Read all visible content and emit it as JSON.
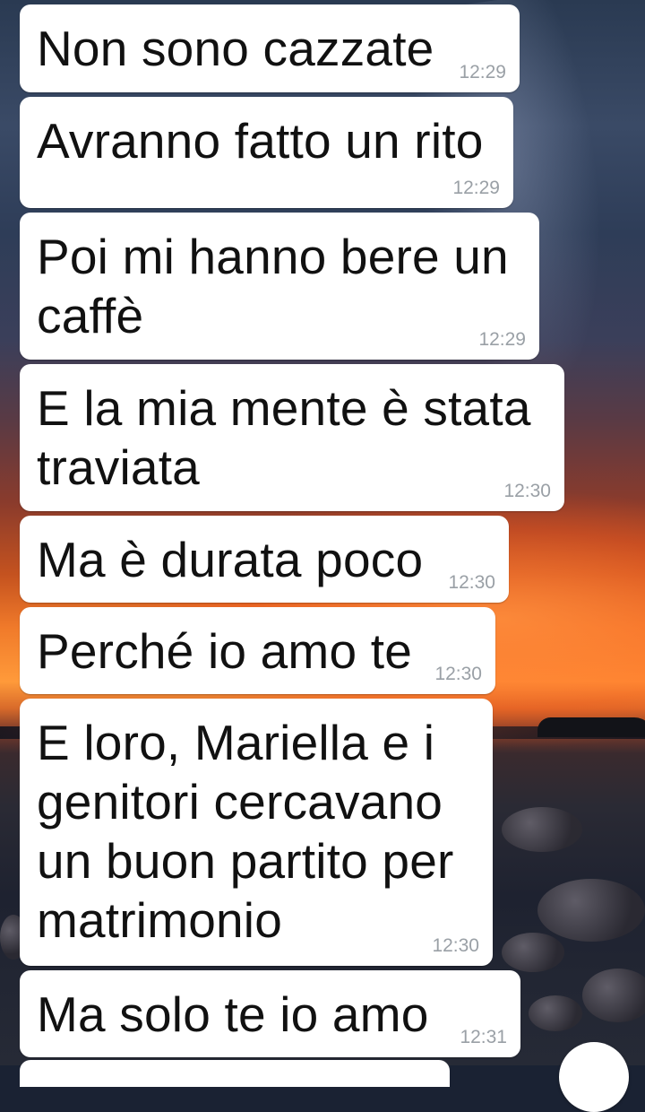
{
  "messages": [
    {
      "text": "Non sono cazzate",
      "time": "12:29"
    },
    {
      "text": "Avranno fatto un rito",
      "time": "12:29"
    },
    {
      "text": "Poi mi hanno bere un\ncaffè",
      "time": "12:29"
    },
    {
      "text": "E la mia mente è stata\ntraviata",
      "time": "12:30"
    },
    {
      "text": "Ma è durata poco",
      "time": "12:30"
    },
    {
      "text": "Perché io amo te",
      "time": "12:30"
    },
    {
      "text": "E loro, Mariella e i\ngenitori cercavano\nun buon partito per\nmatrimonio",
      "time": "12:30"
    },
    {
      "text": "Ma solo te io amo",
      "time": "12:31"
    }
  ],
  "colors": {
    "bubble_bg": "#ffffff",
    "text": "#111111",
    "timestamp": "#9aa0a6"
  }
}
